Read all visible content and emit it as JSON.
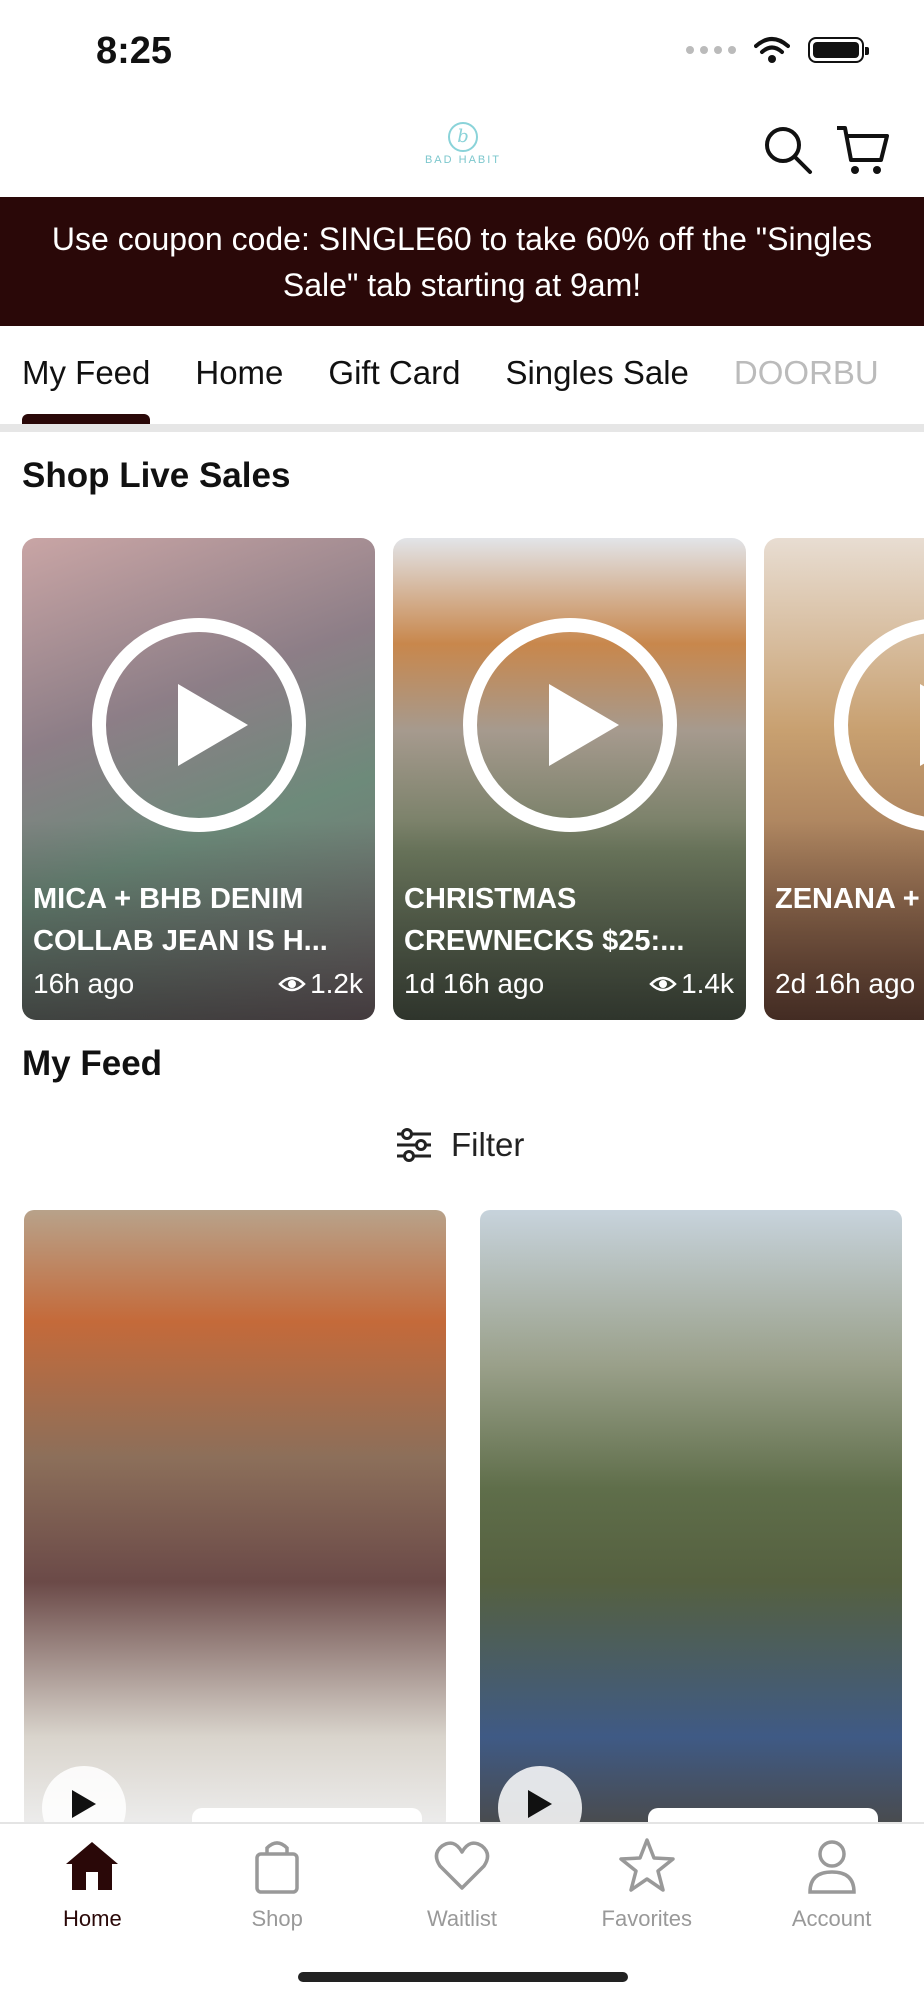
{
  "status": {
    "time": "8:25"
  },
  "header": {
    "logo_text": "BAD HABIT"
  },
  "promo": {
    "text": "Use coupon code: SINGLE60 to take 60% off the \"Singles Sale\" tab starting at 9am!"
  },
  "tabs": [
    {
      "label": "My Feed",
      "active": true
    },
    {
      "label": "Home"
    },
    {
      "label": "Gift Card"
    },
    {
      "label": "Singles Sale"
    },
    {
      "label": "DOORBU"
    }
  ],
  "live_sales": {
    "title": "Shop Live Sales",
    "cards": [
      {
        "title": "MICA + BHB DENIM COLLAB JEAN IS H...",
        "time": "16h ago",
        "views": "1.2k"
      },
      {
        "title": "CHRISTMAS CREWNECKS $25:...",
        "time": "1d 16h ago",
        "views": "1.4k"
      },
      {
        "title": "ZENANA + +BROKE A",
        "time": "2d 16h ago",
        "views": ""
      }
    ]
  },
  "feed": {
    "title": "My Feed",
    "filter_label": "Filter"
  },
  "bottom_nav": [
    {
      "label": "Home",
      "icon": "home-icon",
      "active": true
    },
    {
      "label": "Shop",
      "icon": "shopping-bag-icon"
    },
    {
      "label": "Waitlist",
      "icon": "heart-icon"
    },
    {
      "label": "Favorites",
      "icon": "star-icon"
    },
    {
      "label": "Account",
      "icon": "person-icon"
    }
  ],
  "colors": {
    "brand": "#2a0808",
    "accent_logo": "#8ad3d9"
  }
}
